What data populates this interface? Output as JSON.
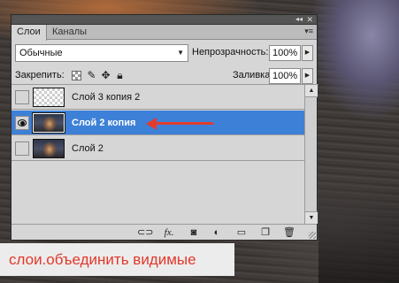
{
  "panel": {
    "tabs": [
      "Слои",
      "Каналы"
    ],
    "blend_mode": "Обычные",
    "opacity_label": "Непрозрачность:",
    "opacity_value": "100%",
    "lock_label": "Закрепить:",
    "fill_label": "Заливка:",
    "fill_value": "100%"
  },
  "layers": [
    {
      "name": "Слой 3 копия 2",
      "visible": false,
      "selected": false,
      "thumbnail": "transparent"
    },
    {
      "name": "Слой 2 копия",
      "visible": true,
      "selected": true,
      "thumbnail": "photo"
    },
    {
      "name": "Слой 2",
      "visible": false,
      "selected": false,
      "thumbnail": "photo"
    }
  ],
  "bottom_tools": [
    "link-layers-icon",
    "fx-icon",
    "mask-icon",
    "adjustment-icon",
    "group-icon",
    "new-layer-icon",
    "trash-icon"
  ],
  "caption": "слои.объединить видимые",
  "colors": {
    "selection": "#3d80d7",
    "caption_text": "#e2382b",
    "arrow": "#e33b2c"
  }
}
